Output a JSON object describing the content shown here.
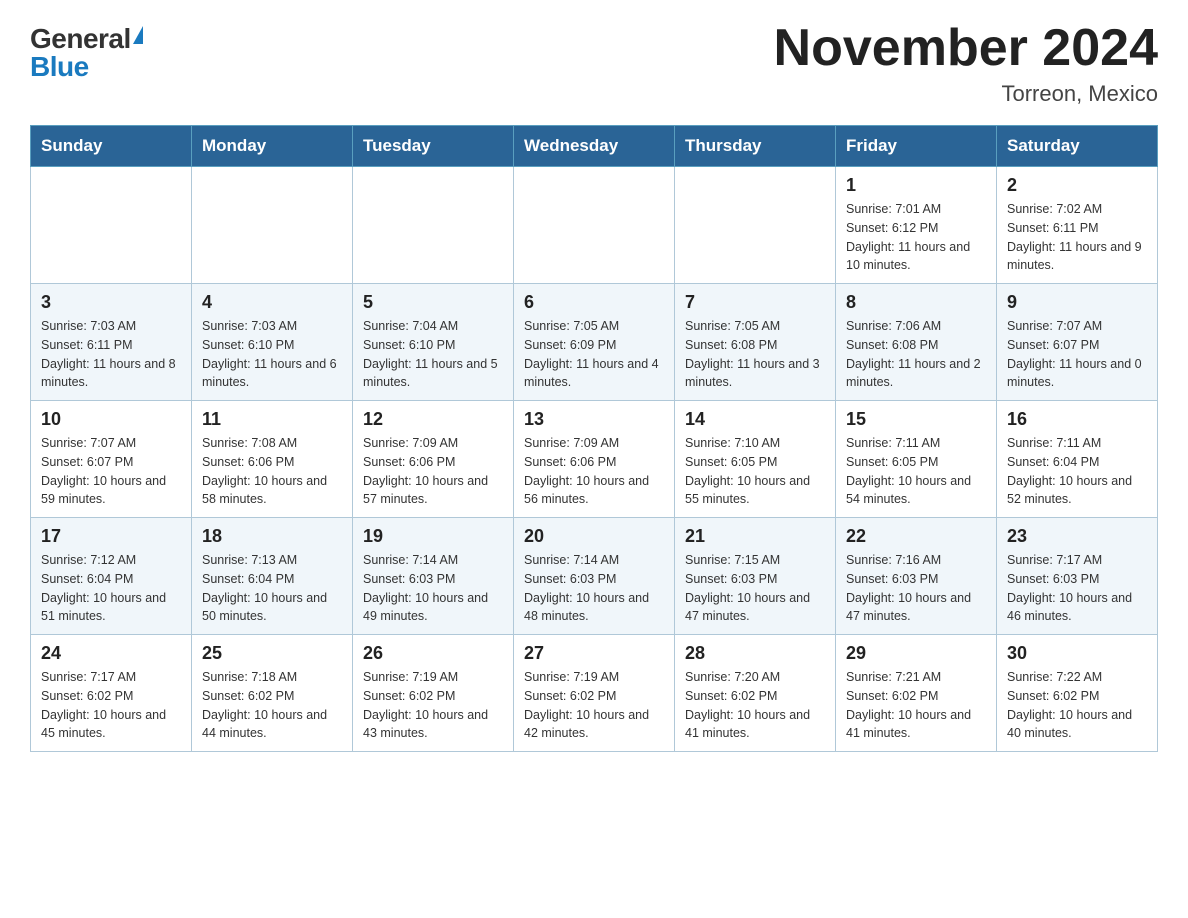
{
  "header": {
    "logo_general": "General",
    "logo_blue": "Blue",
    "title": "November 2024",
    "subtitle": "Torreon, Mexico"
  },
  "weekdays": [
    "Sunday",
    "Monday",
    "Tuesday",
    "Wednesday",
    "Thursday",
    "Friday",
    "Saturday"
  ],
  "weeks": [
    [
      {
        "day": "",
        "info": ""
      },
      {
        "day": "",
        "info": ""
      },
      {
        "day": "",
        "info": ""
      },
      {
        "day": "",
        "info": ""
      },
      {
        "day": "",
        "info": ""
      },
      {
        "day": "1",
        "info": "Sunrise: 7:01 AM\nSunset: 6:12 PM\nDaylight: 11 hours and 10 minutes."
      },
      {
        "day": "2",
        "info": "Sunrise: 7:02 AM\nSunset: 6:11 PM\nDaylight: 11 hours and 9 minutes."
      }
    ],
    [
      {
        "day": "3",
        "info": "Sunrise: 7:03 AM\nSunset: 6:11 PM\nDaylight: 11 hours and 8 minutes."
      },
      {
        "day": "4",
        "info": "Sunrise: 7:03 AM\nSunset: 6:10 PM\nDaylight: 11 hours and 6 minutes."
      },
      {
        "day": "5",
        "info": "Sunrise: 7:04 AM\nSunset: 6:10 PM\nDaylight: 11 hours and 5 minutes."
      },
      {
        "day": "6",
        "info": "Sunrise: 7:05 AM\nSunset: 6:09 PM\nDaylight: 11 hours and 4 minutes."
      },
      {
        "day": "7",
        "info": "Sunrise: 7:05 AM\nSunset: 6:08 PM\nDaylight: 11 hours and 3 minutes."
      },
      {
        "day": "8",
        "info": "Sunrise: 7:06 AM\nSunset: 6:08 PM\nDaylight: 11 hours and 2 minutes."
      },
      {
        "day": "9",
        "info": "Sunrise: 7:07 AM\nSunset: 6:07 PM\nDaylight: 11 hours and 0 minutes."
      }
    ],
    [
      {
        "day": "10",
        "info": "Sunrise: 7:07 AM\nSunset: 6:07 PM\nDaylight: 10 hours and 59 minutes."
      },
      {
        "day": "11",
        "info": "Sunrise: 7:08 AM\nSunset: 6:06 PM\nDaylight: 10 hours and 58 minutes."
      },
      {
        "day": "12",
        "info": "Sunrise: 7:09 AM\nSunset: 6:06 PM\nDaylight: 10 hours and 57 minutes."
      },
      {
        "day": "13",
        "info": "Sunrise: 7:09 AM\nSunset: 6:06 PM\nDaylight: 10 hours and 56 minutes."
      },
      {
        "day": "14",
        "info": "Sunrise: 7:10 AM\nSunset: 6:05 PM\nDaylight: 10 hours and 55 minutes."
      },
      {
        "day": "15",
        "info": "Sunrise: 7:11 AM\nSunset: 6:05 PM\nDaylight: 10 hours and 54 minutes."
      },
      {
        "day": "16",
        "info": "Sunrise: 7:11 AM\nSunset: 6:04 PM\nDaylight: 10 hours and 52 minutes."
      }
    ],
    [
      {
        "day": "17",
        "info": "Sunrise: 7:12 AM\nSunset: 6:04 PM\nDaylight: 10 hours and 51 minutes."
      },
      {
        "day": "18",
        "info": "Sunrise: 7:13 AM\nSunset: 6:04 PM\nDaylight: 10 hours and 50 minutes."
      },
      {
        "day": "19",
        "info": "Sunrise: 7:14 AM\nSunset: 6:03 PM\nDaylight: 10 hours and 49 minutes."
      },
      {
        "day": "20",
        "info": "Sunrise: 7:14 AM\nSunset: 6:03 PM\nDaylight: 10 hours and 48 minutes."
      },
      {
        "day": "21",
        "info": "Sunrise: 7:15 AM\nSunset: 6:03 PM\nDaylight: 10 hours and 47 minutes."
      },
      {
        "day": "22",
        "info": "Sunrise: 7:16 AM\nSunset: 6:03 PM\nDaylight: 10 hours and 47 minutes."
      },
      {
        "day": "23",
        "info": "Sunrise: 7:17 AM\nSunset: 6:03 PM\nDaylight: 10 hours and 46 minutes."
      }
    ],
    [
      {
        "day": "24",
        "info": "Sunrise: 7:17 AM\nSunset: 6:02 PM\nDaylight: 10 hours and 45 minutes."
      },
      {
        "day": "25",
        "info": "Sunrise: 7:18 AM\nSunset: 6:02 PM\nDaylight: 10 hours and 44 minutes."
      },
      {
        "day": "26",
        "info": "Sunrise: 7:19 AM\nSunset: 6:02 PM\nDaylight: 10 hours and 43 minutes."
      },
      {
        "day": "27",
        "info": "Sunrise: 7:19 AM\nSunset: 6:02 PM\nDaylight: 10 hours and 42 minutes."
      },
      {
        "day": "28",
        "info": "Sunrise: 7:20 AM\nSunset: 6:02 PM\nDaylight: 10 hours and 41 minutes."
      },
      {
        "day": "29",
        "info": "Sunrise: 7:21 AM\nSunset: 6:02 PM\nDaylight: 10 hours and 41 minutes."
      },
      {
        "day": "30",
        "info": "Sunrise: 7:22 AM\nSunset: 6:02 PM\nDaylight: 10 hours and 40 minutes."
      }
    ]
  ]
}
